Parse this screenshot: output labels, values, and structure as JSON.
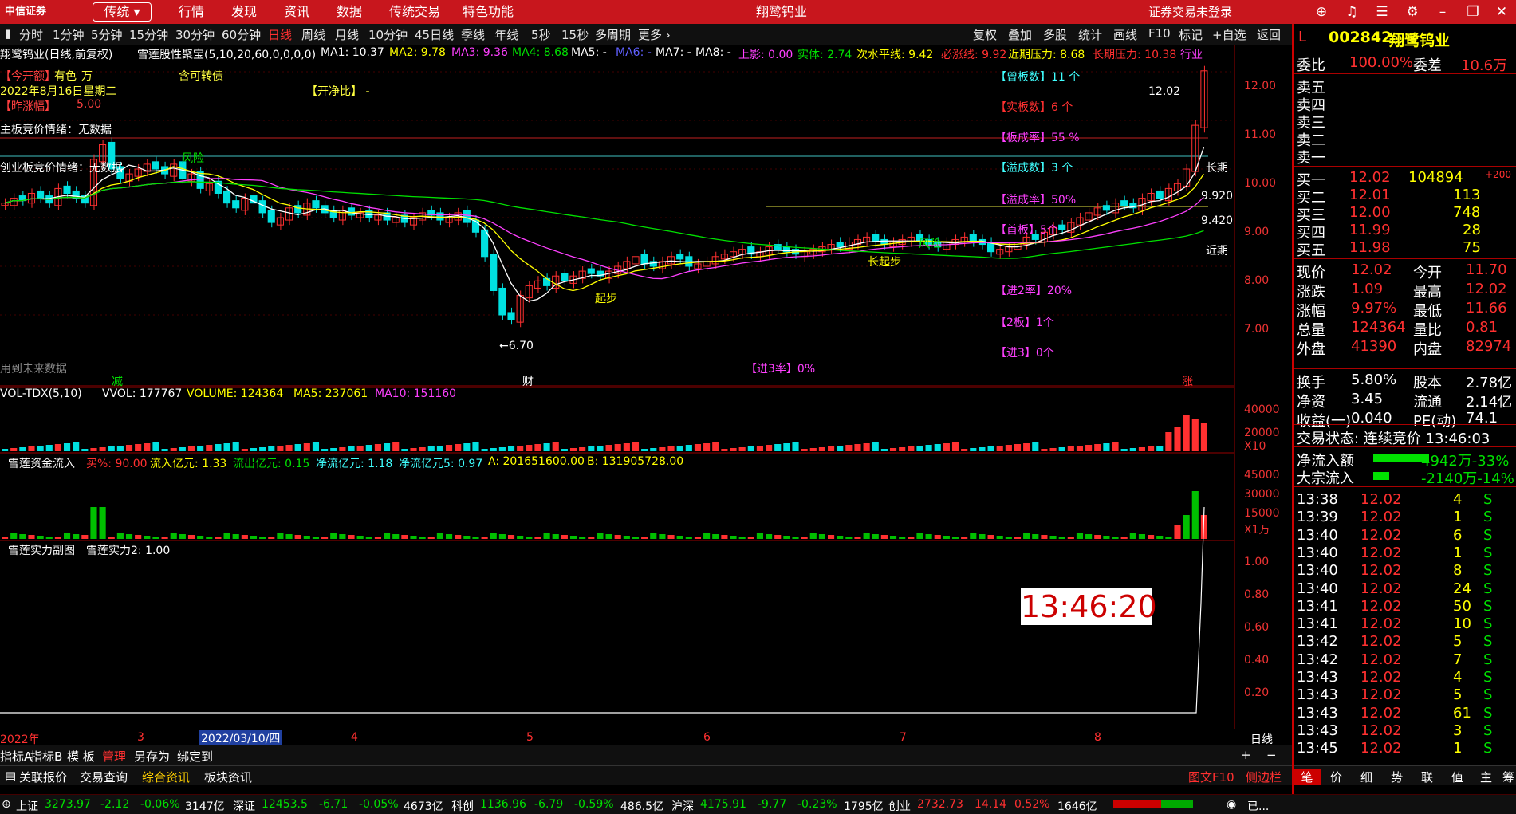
{
  "titlebar": {
    "logo": "中信证券",
    "mode": "传统",
    "menus": [
      "行情",
      "发现",
      "资讯",
      "数据",
      "传统交易",
      "特色功能"
    ],
    "center": "翔鹭钨业",
    "login": "证券交易未登录"
  },
  "periods": [
    "分时",
    "1分钟",
    "5分钟",
    "15分钟",
    "30分钟",
    "60分钟",
    "日线",
    "周线",
    "月线",
    "10分钟",
    "45日线",
    "季线",
    "年线",
    "5秒",
    "15秒",
    "多周期",
    "更多 ›"
  ],
  "active_period": "日线",
  "right_buttons": [
    "复权",
    "叠加",
    "多股",
    "统计",
    "画线",
    "F10",
    "标记",
    "+自选",
    "返回"
  ],
  "stock": {
    "code": "002842",
    "name": "翔鹭钨业"
  },
  "ma_line": {
    "title": "翔鹭钨业(日线,前复权)",
    "indicator": "雪莲股性聚宝(5,10,20,60,0,0,0,0)",
    "ma1": "MA1: 10.37",
    "ma2": "MA2: 9.78",
    "ma3": "MA3: 9.36",
    "ma4": "MA4: 8.68",
    "ma5": "MA5: -",
    "ma6": "MA6: -",
    "ma7": "MA7: -",
    "ma8": "MA8: -",
    "shangying": "上影: 0.00",
    "shiti": "实体: 2.74",
    "cishui": "次水平线: 9.42",
    "biyang": "必涨线: 9.92",
    "jinqi": "近期压力: 8.68",
    "changqi": "长期压力: 10.38",
    "hangye": "行业"
  },
  "left_notes": [
    "【今开额】",
    "有色",
    "万",
    "含可转债",
    "2022年8月16日星期二",
    "【昨涨幅】",
    "5.00",
    "【开净比】 -",
    "主板竞价情绪：无数据",
    "创业板竞价情绪：无数据",
    "风险",
    "用到未来数据",
    "减",
    "财",
    "【进3率】0%"
  ],
  "right_notes": [
    "【曾板数】11 个",
    "【实板数】6 个",
    "【板成率】55 %",
    "【溢成数】3 个",
    "【溢成率】50%",
    "【首板】5个",
    "【进2率】20%",
    "【2板】1个",
    "【进3】0个"
  ],
  "price_labels": [
    "12.02",
    "长期",
    "9.920",
    "9.420",
    "近期",
    "←6.70",
    "长起步",
    "起步",
    "风险",
    "涨"
  ],
  "y_axis": [
    "12.00",
    "11.00",
    "10.00",
    "9.00",
    "8.00",
    "7.00"
  ],
  "vol": {
    "title": "VOL-TDX(5,10)",
    "vvol": "VVOL: 177767",
    "volume": "VOLUME: 124364",
    "ma5": "MA5: 237061",
    "ma10": "MA10: 151160",
    "y": [
      "40000",
      "20000",
      "X10"
    ]
  },
  "fund": {
    "title": "雪莲资金流入",
    "buy": "买%: 90.00",
    "inflow": "流入亿元: 1.33",
    "outflow": "流出亿元: 0.15",
    "net": "净流亿元: 1.18",
    "net5": "净流亿元5: 0.97",
    "a": "A: 201651600.00",
    "b": "B: 131905728.00",
    "y": [
      "45000",
      "30000",
      "15000",
      "X1万"
    ]
  },
  "power": {
    "title": "雪莲实力副图",
    "value": "雪莲实力2: 1.00",
    "y": [
      "1.00",
      "0.80",
      "0.60",
      "0.40",
      "0.20"
    ]
  },
  "x_axis": [
    "2022年",
    "3",
    "2022/03/10/四",
    "4",
    "5",
    "6",
    "7",
    "8",
    "日线"
  ],
  "clock": "13:46:20",
  "tabbar1": [
    "指标A",
    "指标B",
    "模 板",
    "管理",
    "另存为",
    "绑定到"
  ],
  "tabbar2": [
    "关联报价",
    "交易查询",
    "综合资讯",
    "板块资讯",
    "图文F10",
    "侧边栏"
  ],
  "side_tabs": [
    "笔",
    "价",
    "细",
    "势",
    "联",
    "值",
    "主",
    "筹"
  ],
  "quote": {
    "weibi": "委比",
    "weibi_v": "100.00%",
    "weicha": "委差",
    "weicha_v": "10.6万",
    "sells": [
      {
        "n": "卖五"
      },
      {
        "n": "卖四"
      },
      {
        "n": "卖三"
      },
      {
        "n": "卖二"
      },
      {
        "n": "卖一"
      }
    ],
    "buys": [
      {
        "n": "买一",
        "p": "12.02",
        "v": "104894",
        "d": "+200"
      },
      {
        "n": "买二",
        "p": "12.01",
        "v": "113"
      },
      {
        "n": "买三",
        "p": "12.00",
        "v": "748"
      },
      {
        "n": "买四",
        "p": "11.99",
        "v": "28"
      },
      {
        "n": "买五",
        "p": "11.98",
        "v": "75"
      }
    ],
    "stats": [
      [
        "现价",
        "12.02",
        "今开",
        "11.70"
      ],
      [
        "涨跌",
        "1.09",
        "最高",
        "12.02"
      ],
      [
        "涨幅",
        "9.97%",
        "最低",
        "11.66"
      ],
      [
        "总量",
        "124364",
        "量比",
        "0.81"
      ],
      [
        "外盘",
        "41390",
        "内盘",
        "82974"
      ]
    ],
    "stats2": [
      [
        "换手",
        "5.80%",
        "股本",
        "2.78亿"
      ],
      [
        "净资",
        "3.45",
        "流通",
        "2.14亿"
      ],
      [
        "收益(一)",
        "0.040",
        "PE(动)",
        "74.1"
      ]
    ],
    "state": "交易状态: 连续竞价 13:46:03",
    "net_in": "净流入额",
    "net_in_v": "4942万-33%",
    "block_in": "大宗流入",
    "block_in_v": "-2140万-14%",
    "ticks": [
      [
        "13:38",
        "12.02",
        "4",
        "S"
      ],
      [
        "13:39",
        "12.02",
        "1",
        "S"
      ],
      [
        "13:40",
        "12.02",
        "6",
        "S"
      ],
      [
        "13:40",
        "12.02",
        "1",
        "S"
      ],
      [
        "13:40",
        "12.02",
        "8",
        "S"
      ],
      [
        "13:40",
        "12.02",
        "24",
        "S"
      ],
      [
        "13:41",
        "12.02",
        "50",
        "S"
      ],
      [
        "13:41",
        "12.02",
        "10",
        "S"
      ],
      [
        "13:42",
        "12.02",
        "5",
        "S"
      ],
      [
        "13:42",
        "12.02",
        "7",
        "S"
      ],
      [
        "13:43",
        "12.02",
        "4",
        "S"
      ],
      [
        "13:43",
        "12.02",
        "5",
        "S"
      ],
      [
        "13:43",
        "12.02",
        "61",
        "S"
      ],
      [
        "13:43",
        "12.02",
        "3",
        "S"
      ],
      [
        "13:45",
        "12.02",
        "1",
        "S"
      ]
    ]
  },
  "bottombar": [
    "上证",
    "3273.97",
    "-2.12",
    "-0.06%",
    "3147亿",
    "深证",
    "12453.5",
    "-6.71",
    "-0.05%",
    "4673亿",
    "科创",
    "1136.96",
    "-6.79",
    "-0.59%",
    "486.5亿",
    "沪深",
    "4175.91",
    "-9.77",
    "-0.23%",
    "1795亿",
    "创业",
    "2732.73",
    "14.14",
    "0.52%",
    "1646亿",
    "已..."
  ]
}
